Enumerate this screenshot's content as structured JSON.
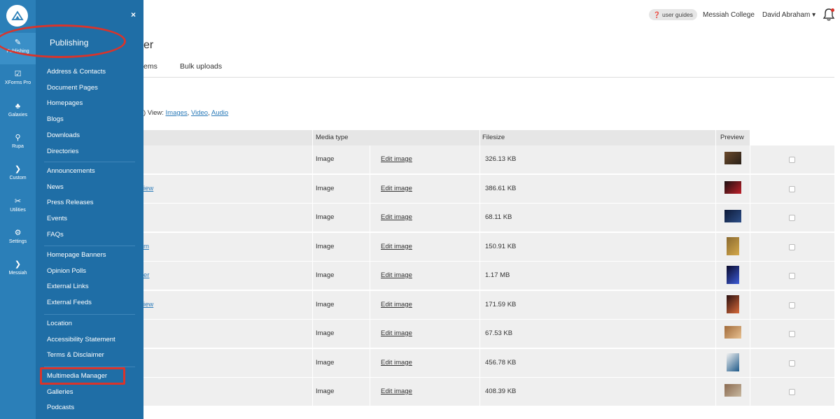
{
  "rail": {
    "items": [
      {
        "label": "Publishing",
        "icon": "pencil-icon",
        "glyph": "✎"
      },
      {
        "label": "XForms Pro",
        "icon": "checkbox-icon",
        "glyph": "☑"
      },
      {
        "label": "Galaxies",
        "icon": "galaxies-icon",
        "glyph": "♣"
      },
      {
        "label": "Rupa",
        "icon": "search-icon",
        "glyph": "⚲"
      },
      {
        "label": "Custom",
        "icon": "chevron-circle-icon",
        "glyph": "❯"
      },
      {
        "label": "Utilities",
        "icon": "wrench-icon",
        "glyph": "✂"
      },
      {
        "label": "Settings",
        "icon": "gears-icon",
        "glyph": "⚙"
      },
      {
        "label": "Messiah",
        "icon": "chevron-circle-icon",
        "glyph": "❯"
      }
    ]
  },
  "menu": {
    "title": "Publishing",
    "close": "×",
    "groups": [
      [
        "Address & Contacts",
        "Document Pages",
        "Homepages",
        "Blogs",
        "Downloads",
        "Directories"
      ],
      [
        "Announcements",
        "News",
        "Press Releases",
        "Events",
        "FAQs"
      ],
      [
        "Homepage Banners",
        "Opinion Polls",
        "External Links",
        "External Feeds"
      ],
      [
        "Location",
        "Accessibility Statement",
        "Terms & Disclaimer"
      ],
      [
        "Multimedia Manager",
        "Galleries",
        "Podcasts"
      ]
    ]
  },
  "topbar": {
    "guides": "user guides",
    "college": "Messiah College",
    "user": "David Abraham"
  },
  "main": {
    "title_fragment": "er",
    "tabs": [
      "ems",
      "Bulk uploads"
    ],
    "view_prefix": ") View: ",
    "view_links": [
      "Images",
      "Video",
      "Audio"
    ],
    "view_seps": [
      ", ",
      ", "
    ]
  },
  "table": {
    "headers": {
      "media_type": "Media type",
      "filesize": "Filesize",
      "preview": "Preview"
    },
    "rows": [
      {
        "frag": "",
        "type": "Image",
        "edit": "Edit image",
        "size": "326.13 KB",
        "thumb": [
          "#6b4a2c",
          "#2a2018"
        ],
        "tall": false
      },
      {
        "frag": "iew",
        "type": "Image",
        "edit": "Edit image",
        "size": "386.61 KB",
        "thumb": [
          "#1a1010",
          "#c0202a"
        ],
        "tall": false
      },
      {
        "frag": "",
        "type": "Image",
        "edit": "Edit image",
        "size": "68.11 KB",
        "thumb": [
          "#0e1a38",
          "#2d4f88"
        ],
        "tall": false
      },
      {
        "frag": "m",
        "type": "Image",
        "edit": "Edit image",
        "size": "150.91 KB",
        "thumb": [
          "#8a6a30",
          "#d4a84a"
        ],
        "tall": true
      },
      {
        "frag": "er",
        "type": "Image",
        "edit": "Edit image",
        "size": "1.17 MB",
        "thumb": [
          "#0a0a2a",
          "#3d5cd8"
        ],
        "tall": true
      },
      {
        "frag": "iew",
        "type": "Image",
        "edit": "Edit image",
        "size": "171.59 KB",
        "thumb": [
          "#2a1010",
          "#d86a3a"
        ],
        "tall": true
      },
      {
        "frag": "",
        "type": "Image",
        "edit": "Edit image",
        "size": "67.53 KB",
        "thumb": [
          "#a06a3a",
          "#e8c090"
        ],
        "tall": false
      },
      {
        "frag": "",
        "type": "Image",
        "edit": "Edit image",
        "size": "456.78 KB",
        "thumb": [
          "#f0f0f0",
          "#1f5a8a"
        ],
        "tall": true
      },
      {
        "frag": "",
        "type": "Image",
        "edit": "Edit image",
        "size": "408.39 KB",
        "thumb": [
          "#8a6a50",
          "#c8b8a0"
        ],
        "tall": false
      }
    ]
  },
  "colors": {
    "rail": "#2b7fb8",
    "menu": "#1f6ea6",
    "annotation": "#d9342b",
    "link": "#2a7ab8"
  }
}
